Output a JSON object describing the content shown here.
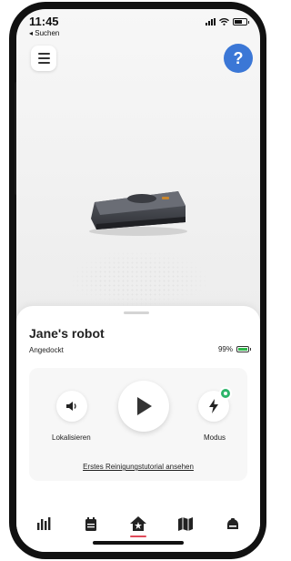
{
  "status_bar": {
    "time": "11:45",
    "back_label": "◂ Suchen"
  },
  "header": {
    "help_label": "?"
  },
  "robot": {
    "name": "Jane's robot",
    "status": "Angedockt",
    "battery": "99%",
    "battery_level": 0.99
  },
  "controls": {
    "locate_label": "Lokalisieren",
    "mode_label": "Modus",
    "tutorial_link": "Erstes Reinigungstutorial ansehen"
  },
  "tabs": [
    {
      "icon": "stats-icon"
    },
    {
      "icon": "schedule-icon"
    },
    {
      "icon": "home-icon",
      "active": true
    },
    {
      "icon": "map-icon"
    },
    {
      "icon": "robot-icon"
    }
  ],
  "colors": {
    "accent": "#3b77d6",
    "battery": "#2fb84a",
    "mode_badge": "#2db56a",
    "active_tab": "#e04a5a"
  }
}
